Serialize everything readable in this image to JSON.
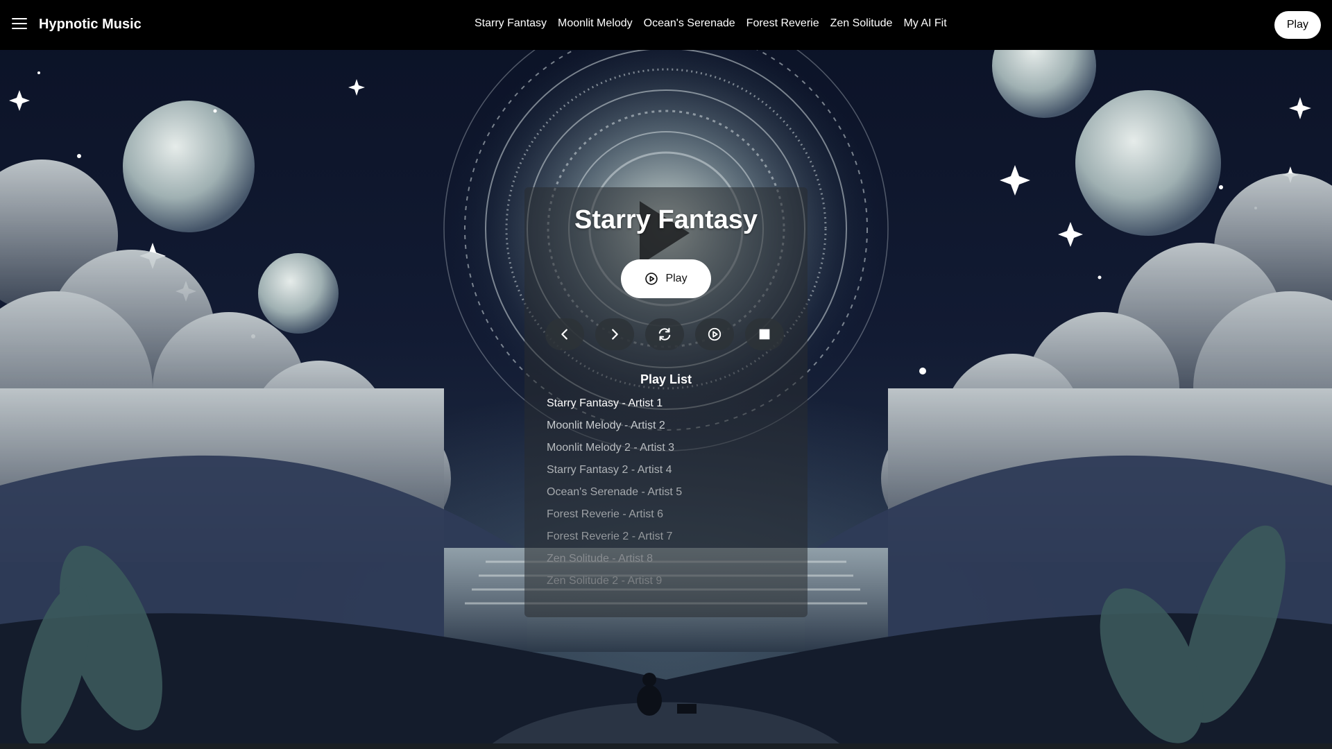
{
  "navbar": {
    "brand": "Hypnotic Music",
    "links": [
      "Starry Fantasy",
      "Moonlit Melody",
      "Ocean's Serenade",
      "Forest Reverie",
      "Zen Solitude",
      "My AI Fit"
    ],
    "play_label": "Play"
  },
  "player": {
    "title": "Starry Fantasy",
    "play_label": "Play",
    "controls": [
      {
        "icon": "chevron-left-icon"
      },
      {
        "icon": "chevron-right-icon"
      },
      {
        "icon": "repeat-icon"
      },
      {
        "icon": "play-circle-icon"
      },
      {
        "icon": "stop-icon"
      }
    ]
  },
  "playlist": {
    "title": "Play List",
    "items": [
      "Starry Fantasy - Artist 1",
      "Moonlit Melody - Artist 2",
      "Moonlit Melody 2 - Artist 3",
      "Starry Fantasy 2 - Artist 4",
      "Ocean's Serenade - Artist 5",
      "Forest Reverie - Artist 6",
      "Forest Reverie 2 - Artist 7",
      "Zen Solitude - Artist 8",
      "Zen Solitude 2 - Artist 9"
    ],
    "active_index": 0
  },
  "colors": {
    "navbar_bg": "#000000",
    "button_bg": "#ffffff",
    "panel_bg": "#282c30"
  }
}
